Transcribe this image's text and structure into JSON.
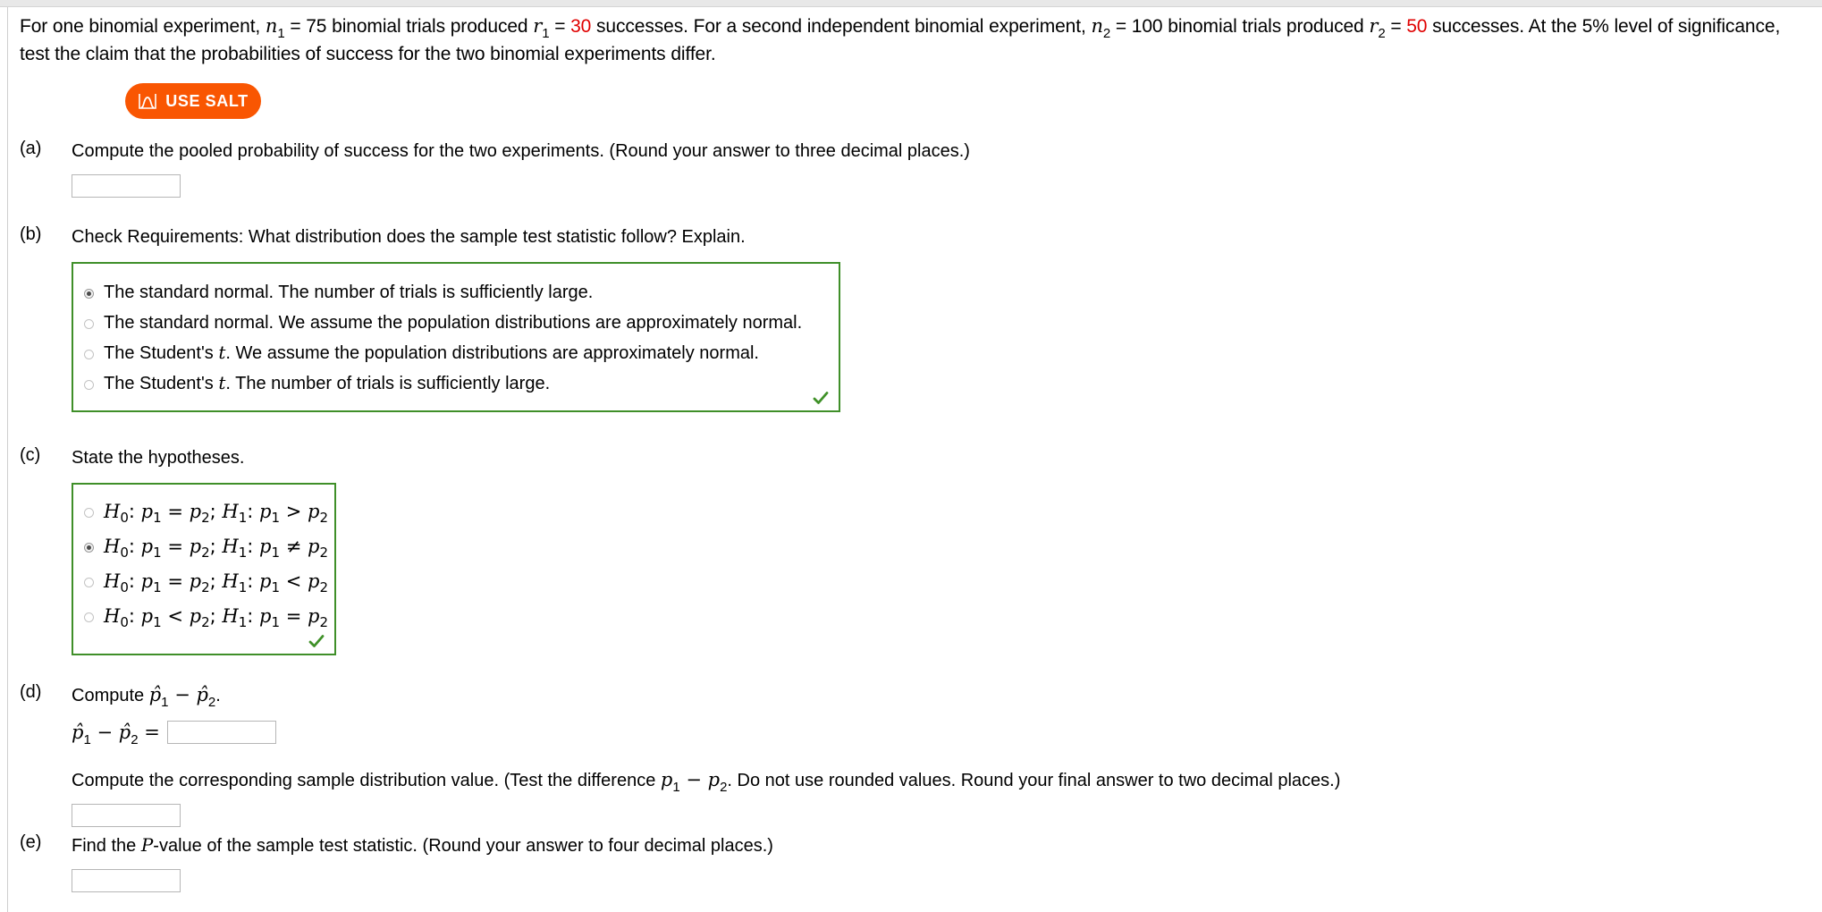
{
  "statement": {
    "line1_a": "For one binomial experiment, ",
    "n1": "n",
    "n1_sub": "1",
    "eq1": " = 75 binomial trials produced ",
    "r1": "r",
    "r1_sub": "1",
    "eq2": " = ",
    "r1_value": "30",
    "after_r1": " successes. For a second independent binomial experiment, ",
    "n2": "n",
    "n2_sub": "2",
    "eq3": " = 100 binomial trials produced ",
    "r2": "r",
    "r2_sub": "2",
    "eq4": " = ",
    "r2_value": "50",
    "after_r2": " successes. At the 5% level of significance,",
    "line2": "test the claim that the probabilities of success for the two binomial experiments differ."
  },
  "salt_button": {
    "label": "USE SALT",
    "icon": "distribution-curve-icon",
    "color": "#f95602"
  },
  "parts": {
    "a": {
      "label": "(a)",
      "prompt": "Compute the pooled probability of success for the two experiments. (Round your answer to three decimal places.)",
      "input_value": ""
    },
    "b": {
      "label": "(b)",
      "prompt": "Check Requirements: What distribution does the sample test statistic follow? Explain.",
      "options": [
        {
          "text_pre": "The standard normal. The number of trials is sufficiently large.",
          "italic": "",
          "text_post": "",
          "selected": true
        },
        {
          "text_pre": "The standard normal. We assume the population distributions are approximately normal.",
          "italic": "",
          "text_post": "",
          "selected": false
        },
        {
          "text_pre": "The Student's ",
          "italic": "t",
          "text_post": ". We assume the population distributions are approximately normal.",
          "selected": false
        },
        {
          "text_pre": "The Student's ",
          "italic": "t",
          "text_post": ". The number of trials is sufficiently large.",
          "selected": false
        }
      ],
      "status": "correct-checkmark",
      "status_color": "#3f9128"
    },
    "c": {
      "label": "(c)",
      "prompt": "State the hypotheses.",
      "options": [
        {
          "null_var": "H",
          "null_sub": "0",
          "p_a": "p",
          "p_a_sub": "1",
          "rel1": "=",
          "p_b": "p",
          "p_b_sub": "2",
          "alt_var": "H",
          "alt_sub": "1",
          "p_c": "p",
          "p_c_sub": "1",
          "rel2": ">",
          "p_d": "p",
          "p_d_sub": "2",
          "selected": false
        },
        {
          "null_var": "H",
          "null_sub": "0",
          "p_a": "p",
          "p_a_sub": "1",
          "rel1": "=",
          "p_b": "p",
          "p_b_sub": "2",
          "alt_var": "H",
          "alt_sub": "1",
          "p_c": "p",
          "p_c_sub": "1",
          "rel2": "≠",
          "p_d": "p",
          "p_d_sub": "2",
          "selected": true
        },
        {
          "null_var": "H",
          "null_sub": "0",
          "p_a": "p",
          "p_a_sub": "1",
          "rel1": "=",
          "p_b": "p",
          "p_b_sub": "2",
          "alt_var": "H",
          "alt_sub": "1",
          "p_c": "p",
          "p_c_sub": "1",
          "rel2": "<",
          "p_d": "p",
          "p_d_sub": "2",
          "selected": false
        },
        {
          "null_var": "H",
          "null_sub": "0",
          "p_a": "p",
          "p_a_sub": "1",
          "rel1": "<",
          "p_b": "p",
          "p_b_sub": "2",
          "alt_var": "H",
          "alt_sub": "1",
          "p_c": "p",
          "p_c_sub": "1",
          "rel2": "=",
          "p_d": "p",
          "p_d_sub": "2",
          "selected": false
        }
      ],
      "status": "correct-checkmark",
      "status_color": "#3f9128"
    },
    "d": {
      "label": "(d)",
      "prompt_pre": "Compute ",
      "prompt_math": "p̂1 − p̂2",
      "prompt_post": ".",
      "equation_label": "p̂1 − p̂2 =",
      "input_value": "",
      "prompt2_pre": "Compute the corresponding sample distribution value. (Test the difference ",
      "prompt2_math": "p1 − p2",
      "prompt2_post": ". Do not use rounded values. Round your final answer to two decimal places.)",
      "input2_value": ""
    },
    "e": {
      "label": "(e)",
      "prompt_pre": "Find the ",
      "prompt_italic": "P",
      "prompt_post": "-value of the sample test statistic. (Round your answer to four decimal places.)",
      "input_value": ""
    }
  }
}
